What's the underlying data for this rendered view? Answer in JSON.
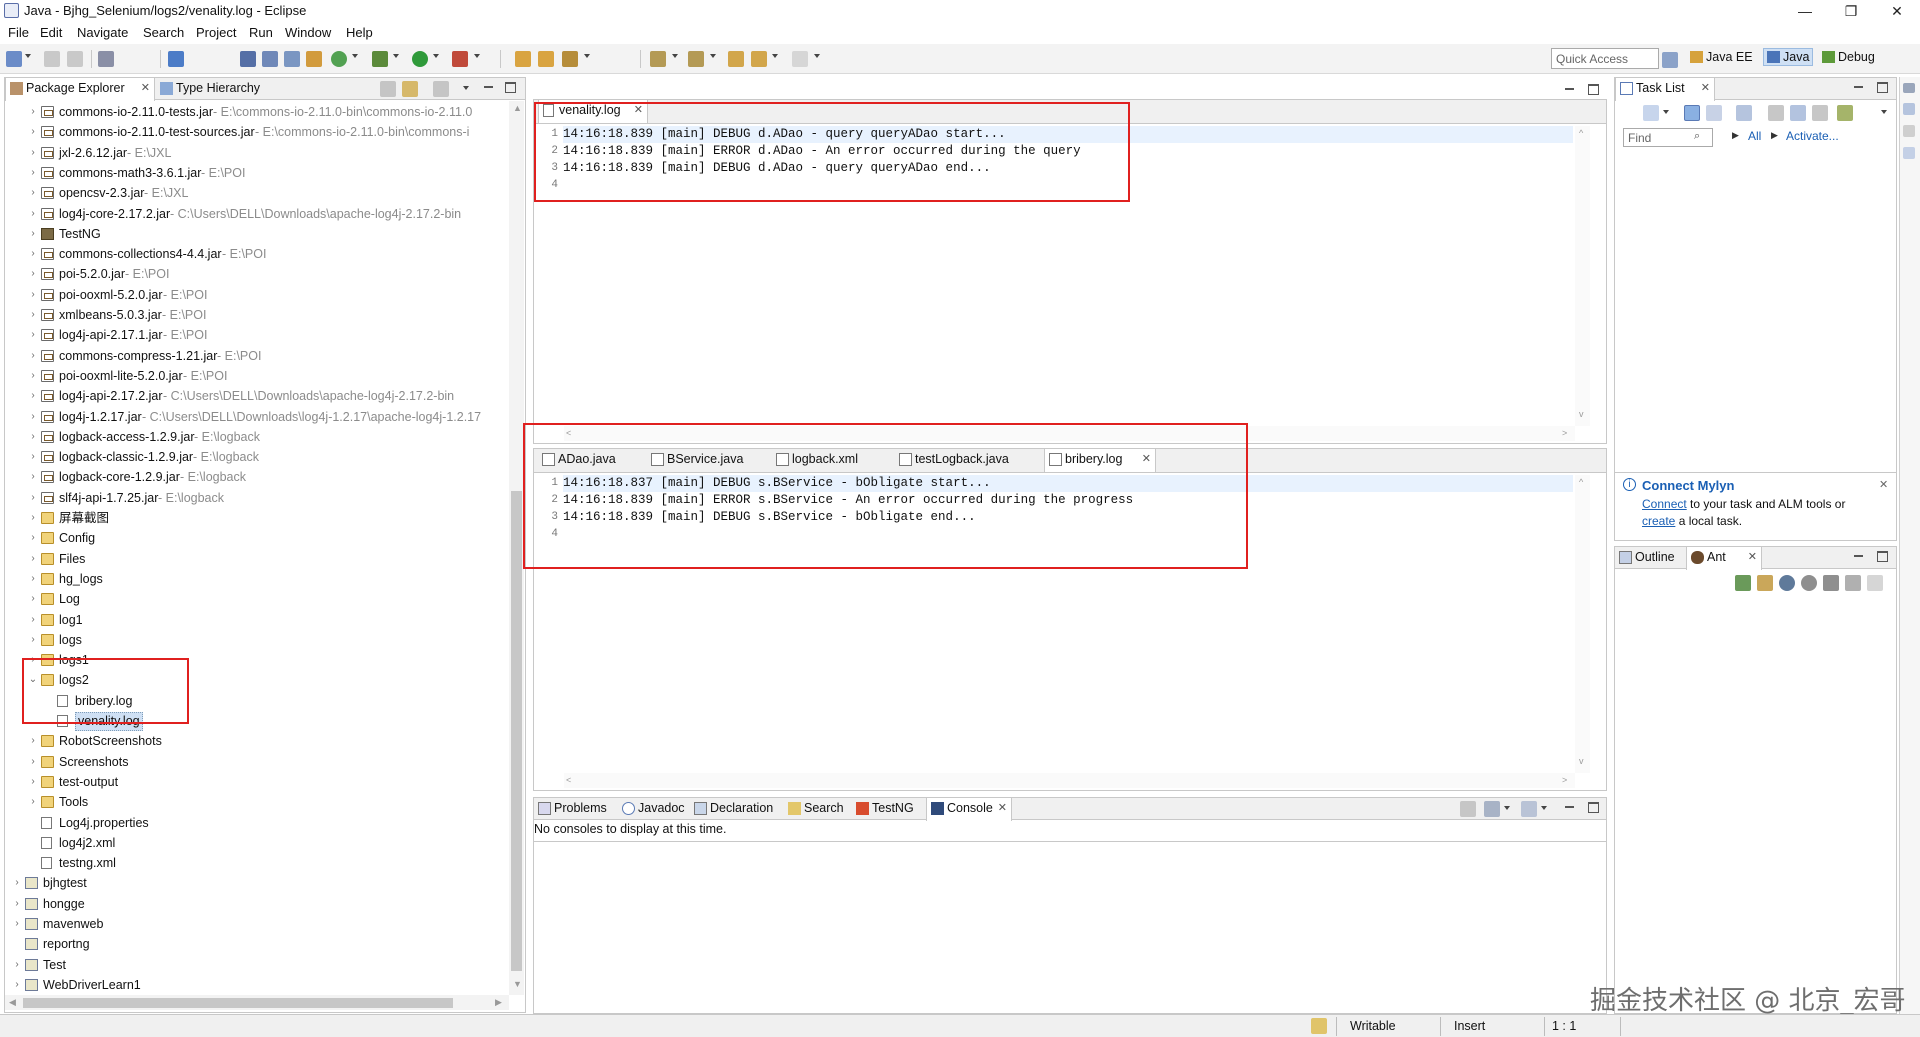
{
  "window": {
    "title": "Java - Bjhg_Selenium/logs2/venality.log - Eclipse",
    "minimize": "—",
    "restore": "❐",
    "close": "✕"
  },
  "menu": [
    "File",
    "Edit",
    "Navigate",
    "Search",
    "Project",
    "Run",
    "Window",
    "Help"
  ],
  "toolbar": {
    "quick_access_placeholder": "Quick Access",
    "perspectives": [
      {
        "label": "Java EE",
        "selected": false
      },
      {
        "label": "Java",
        "selected": true
      },
      {
        "label": "Debug",
        "selected": false
      }
    ]
  },
  "left_panel": {
    "tabs": [
      "Package Explorer",
      "Type Hierarchy"
    ],
    "tree": [
      {
        "depth": 1,
        "twisty": ">",
        "icon": "jar",
        "label": "commons-io-2.11.0-tests.jar",
        "path": " - E:\\commons-io-2.11.0-bin\\commons-io-2.11.0"
      },
      {
        "depth": 1,
        "twisty": ">",
        "icon": "jar",
        "label": "commons-io-2.11.0-test-sources.jar",
        "path": " - E:\\commons-io-2.11.0-bin\\commons-i"
      },
      {
        "depth": 1,
        "twisty": ">",
        "icon": "jar",
        "label": "jxl-2.6.12.jar",
        "path": " - E:\\JXL"
      },
      {
        "depth": 1,
        "twisty": ">",
        "icon": "jar",
        "label": "commons-math3-3.6.1.jar",
        "path": " - E:\\POI"
      },
      {
        "depth": 1,
        "twisty": ">",
        "icon": "jar",
        "label": "opencsv-2.3.jar",
        "path": " - E:\\JXL"
      },
      {
        "depth": 1,
        "twisty": ">",
        "icon": "jar",
        "label": "log4j-core-2.17.2.jar",
        "path": " - C:\\Users\\DELL\\Downloads\\apache-log4j-2.17.2-bin"
      },
      {
        "depth": 1,
        "twisty": ">",
        "icon": "lib",
        "label": "TestNG",
        "path": ""
      },
      {
        "depth": 1,
        "twisty": ">",
        "icon": "jar",
        "label": "commons-collections4-4.4.jar",
        "path": " - E:\\POI"
      },
      {
        "depth": 1,
        "twisty": ">",
        "icon": "jar",
        "label": "poi-5.2.0.jar",
        "path": " - E:\\POI"
      },
      {
        "depth": 1,
        "twisty": ">",
        "icon": "jar",
        "label": "poi-ooxml-5.2.0.jar",
        "path": " - E:\\POI"
      },
      {
        "depth": 1,
        "twisty": ">",
        "icon": "jar",
        "label": "xmlbeans-5.0.3.jar",
        "path": " - E:\\POI"
      },
      {
        "depth": 1,
        "twisty": ">",
        "icon": "jar",
        "label": "log4j-api-2.17.1.jar",
        "path": " - E:\\POI"
      },
      {
        "depth": 1,
        "twisty": ">",
        "icon": "jar",
        "label": "commons-compress-1.21.jar",
        "path": " - E:\\POI"
      },
      {
        "depth": 1,
        "twisty": ">",
        "icon": "jar",
        "label": "poi-ooxml-lite-5.2.0.jar",
        "path": " - E:\\POI"
      },
      {
        "depth": 1,
        "twisty": ">",
        "icon": "jar",
        "label": "log4j-api-2.17.2.jar",
        "path": " - C:\\Users\\DELL\\Downloads\\apache-log4j-2.17.2-bin"
      },
      {
        "depth": 1,
        "twisty": ">",
        "icon": "jar",
        "label": "log4j-1.2.17.jar",
        "path": " - C:\\Users\\DELL\\Downloads\\log4j-1.2.17\\apache-log4j-1.2.17"
      },
      {
        "depth": 1,
        "twisty": ">",
        "icon": "jar",
        "label": "logback-access-1.2.9.jar",
        "path": " - E:\\logback"
      },
      {
        "depth": 1,
        "twisty": ">",
        "icon": "jar",
        "label": "logback-classic-1.2.9.jar",
        "path": " - E:\\logback"
      },
      {
        "depth": 1,
        "twisty": ">",
        "icon": "jar",
        "label": "logback-core-1.2.9.jar",
        "path": " - E:\\logback"
      },
      {
        "depth": 1,
        "twisty": ">",
        "icon": "jar",
        "label": "slf4j-api-1.7.25.jar",
        "path": " - E:\\logback"
      },
      {
        "depth": 1,
        "twisty": ">",
        "icon": "folder",
        "label": "屏幕截图",
        "path": ""
      },
      {
        "depth": 1,
        "twisty": ">",
        "icon": "folder",
        "label": "Config",
        "path": ""
      },
      {
        "depth": 1,
        "twisty": ">",
        "icon": "folder",
        "label": "Files",
        "path": ""
      },
      {
        "depth": 1,
        "twisty": ">",
        "icon": "folder",
        "label": "hg_logs",
        "path": ""
      },
      {
        "depth": 1,
        "twisty": ">",
        "icon": "folder",
        "label": "Log",
        "path": ""
      },
      {
        "depth": 1,
        "twisty": ">",
        "icon": "folder",
        "label": "log1",
        "path": ""
      },
      {
        "depth": 1,
        "twisty": ">",
        "icon": "folder",
        "label": "logs",
        "path": ""
      },
      {
        "depth": 1,
        "twisty": ">",
        "icon": "folder",
        "label": "logs1",
        "path": ""
      },
      {
        "depth": 1,
        "twisty": "v",
        "icon": "folder",
        "label": "logs2",
        "path": ""
      },
      {
        "depth": 2,
        "twisty": "",
        "icon": "file",
        "label": "bribery.log",
        "path": ""
      },
      {
        "depth": 2,
        "twisty": "",
        "icon": "file",
        "label": "venality.log",
        "path": "",
        "selected": true
      },
      {
        "depth": 1,
        "twisty": ">",
        "icon": "folder",
        "label": "RobotScreenshots",
        "path": ""
      },
      {
        "depth": 1,
        "twisty": ">",
        "icon": "folder",
        "label": "Screenshots",
        "path": ""
      },
      {
        "depth": 1,
        "twisty": ">",
        "icon": "folder",
        "label": "test-output",
        "path": ""
      },
      {
        "depth": 1,
        "twisty": ">",
        "icon": "folder",
        "label": "Tools",
        "path": ""
      },
      {
        "depth": 1,
        "twisty": "",
        "icon": "file",
        "label": "Log4j.properties",
        "path": ""
      },
      {
        "depth": 1,
        "twisty": "",
        "icon": "xml",
        "label": "log4j2.xml",
        "path": ""
      },
      {
        "depth": 1,
        "twisty": "",
        "icon": "xml",
        "label": "testng.xml",
        "path": ""
      },
      {
        "depth": 0,
        "twisty": ">",
        "icon": "project",
        "label": "bjhgtest",
        "path": ""
      },
      {
        "depth": 0,
        "twisty": ">",
        "icon": "project",
        "label": "hongge",
        "path": ""
      },
      {
        "depth": 0,
        "twisty": ">",
        "icon": "project",
        "label": "mavenweb",
        "path": ""
      },
      {
        "depth": 0,
        "twisty": "",
        "icon": "project",
        "label": "reportng",
        "path": ""
      },
      {
        "depth": 0,
        "twisty": ">",
        "icon": "project",
        "label": "Test",
        "path": ""
      },
      {
        "depth": 0,
        "twisty": ">",
        "icon": "project",
        "label": "WebDriverLearn1",
        "path": ""
      }
    ]
  },
  "editor_top": {
    "tabs": [
      {
        "label": "venality.log",
        "active": true
      }
    ],
    "lines": [
      {
        "num": "1",
        "text": "14:16:18.839 [main] DEBUG d.ADao - query queryADao start..."
      },
      {
        "num": "2",
        "text": "14:16:18.839 [main] ERROR d.ADao - An error occurred during the query"
      },
      {
        "num": "3",
        "text": "14:16:18.839 [main] DEBUG d.ADao - query queryADao end..."
      },
      {
        "num": "4",
        "text": ""
      }
    ]
  },
  "editor_bottom": {
    "tabs": [
      {
        "label": "ADao.java",
        "active": false,
        "icon": "java"
      },
      {
        "label": "BService.java",
        "active": false,
        "icon": "java"
      },
      {
        "label": "logback.xml",
        "active": false,
        "icon": "xml"
      },
      {
        "label": "testLogback.java",
        "active": false,
        "icon": "java"
      },
      {
        "label": "bribery.log",
        "active": true,
        "icon": "file"
      }
    ],
    "lines": [
      {
        "num": "1",
        "text": "14:16:18.837 [main] DEBUG s.BService - bObligate start..."
      },
      {
        "num": "2",
        "text": "14:16:18.839 [main] ERROR s.BService - An error occurred during the progress"
      },
      {
        "num": "3",
        "text": "14:16:18.839 [main] DEBUG s.BService - bObligate end..."
      },
      {
        "num": "4",
        "text": ""
      }
    ]
  },
  "bottom_panel": {
    "tabs": [
      {
        "label": "Problems",
        "active": false
      },
      {
        "label": "Javadoc",
        "active": false
      },
      {
        "label": "Declaration",
        "active": false
      },
      {
        "label": "Search",
        "active": false
      },
      {
        "label": "TestNG",
        "active": false
      },
      {
        "label": "Console",
        "active": true
      }
    ],
    "message": "No consoles to display at this time."
  },
  "task_list": {
    "tab": "Task List",
    "find_placeholder": "Find",
    "all_label": "All",
    "activate_label": "Activate..."
  },
  "mylyn": {
    "title": "Connect Mylyn",
    "connect_link": "Connect",
    "text1": " to your task and ALM tools or",
    "create_link": "create",
    "text2": " a local task."
  },
  "outline": {
    "tabs": [
      "Outline",
      "Ant"
    ]
  },
  "status": {
    "writable": "Writable",
    "insert": "Insert",
    "position": "1 : 1"
  },
  "watermark": "掘金技术社区 @ 北京_宏哥",
  "colors": {
    "highlight_box": "#e0201f",
    "selection": "#cfe0f4",
    "link": "#1a5fb4"
  }
}
